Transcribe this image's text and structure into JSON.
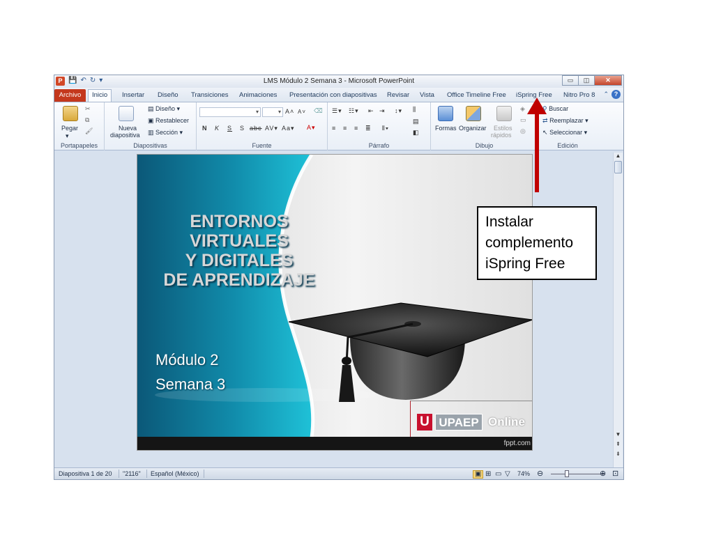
{
  "window": {
    "title": "LMS Módulo 2 Semana 3  -  Microsoft PowerPoint",
    "app_icon": "P",
    "controls": {
      "minimize": "▭",
      "restore": "◫",
      "close": "✕"
    }
  },
  "tabs": [
    {
      "label": "Archivo"
    },
    {
      "label": "Inicio"
    },
    {
      "label": "Insertar"
    },
    {
      "label": "Diseño"
    },
    {
      "label": "Transiciones"
    },
    {
      "label": "Animaciones"
    },
    {
      "label": "Presentación con diapositivas"
    },
    {
      "label": "Revisar"
    },
    {
      "label": "Vista"
    },
    {
      "label": "Office Timeline Free"
    },
    {
      "label": "iSpring Free"
    },
    {
      "label": "Nitro Pro 8"
    }
  ],
  "ribbon": {
    "clipboard": {
      "paste": "Pegar",
      "group": "Portapapeles"
    },
    "slides": {
      "new_slide_1": "Nueva",
      "new_slide_2": "diapositiva",
      "layout": "Diseño",
      "reset": "Restablecer",
      "section": "Sección",
      "group": "Diapositivas"
    },
    "font": {
      "group": "Fuente",
      "bold": "N",
      "italic": "K",
      "underline": "S",
      "shadow": "S",
      "strike": "abc",
      "spacing": "AV",
      "case": "Aa",
      "grow": "A",
      "shrink": "A",
      "color": "A"
    },
    "paragraph": {
      "group": "Párrafo"
    },
    "drawing": {
      "shapes": "Formas",
      "arrange": "Organizar",
      "quick_styles_1": "Estilos",
      "quick_styles_2": "rápidos",
      "group": "Dibujo"
    },
    "editing": {
      "find": "Buscar",
      "replace": "Reemplazar",
      "select": "Seleccionar",
      "group": "Edición"
    }
  },
  "slide": {
    "title_lines": [
      "ENTORNOS",
      "VIRTUALES",
      "Y DIGITALES",
      "DE APRENDIZAJE"
    ],
    "subtitle_lines": [
      "Módulo 2",
      "Semana 3"
    ],
    "brand_u": "U",
    "brand_upaep": "UPAEP",
    "brand_online": "Online",
    "footer": "fppt.com"
  },
  "status": {
    "slide_info": "Diapositiva 1 de 20",
    "theme": "\"2116\"",
    "language": "Español (México)",
    "zoom": "74%"
  },
  "callout": {
    "lines": [
      "Instalar",
      "complemento",
      "iSpring Free"
    ]
  },
  "colors": {
    "arrow": "#c00000",
    "file_tab": "#c4381d",
    "brand_red": "#c8102e",
    "slide_teal": "#0f89a6"
  }
}
